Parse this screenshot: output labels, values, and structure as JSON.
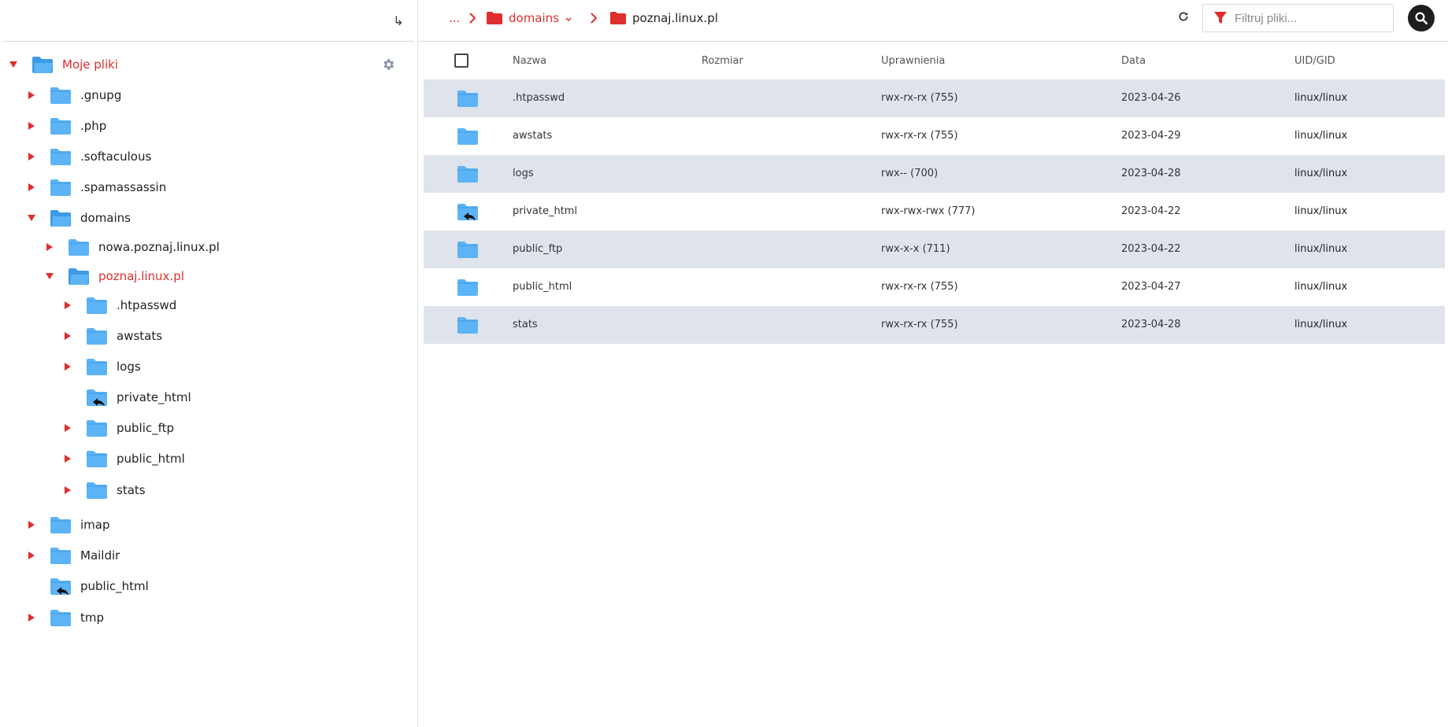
{
  "colors": {
    "accent": "#e02d2d",
    "folder": "#5cb3f5",
    "folder_dark": "#3d9be6",
    "row_shaded": "#dfe4ec"
  },
  "sidebar": {
    "collapse_icon": "arrow-down-right-icon",
    "root": {
      "label": "Moje pliki",
      "expanded": true
    },
    "settings_icon": "gear-icon",
    "tree": [
      {
        "label": ".gnupg",
        "toggle": "collapsed",
        "icon": "folder"
      },
      {
        "label": ".php",
        "toggle": "collapsed",
        "icon": "folder"
      },
      {
        "label": ".softaculous",
        "toggle": "collapsed",
        "icon": "folder"
      },
      {
        "label": ".spamassassin",
        "toggle": "collapsed",
        "icon": "folder"
      },
      {
        "label": "domains",
        "toggle": "expanded",
        "icon": "folder-open"
      },
      {
        "label": "nowa.poznaj.linux.pl",
        "toggle": "collapsed",
        "icon": "folder"
      },
      {
        "label": "poznaj.linux.pl",
        "toggle": "expanded",
        "icon": "folder-open",
        "active": true
      },
      {
        "label": ".htpasswd",
        "toggle": "collapsed",
        "icon": "folder"
      },
      {
        "label": "awstats",
        "toggle": "collapsed",
        "icon": "folder"
      },
      {
        "label": "logs",
        "toggle": "collapsed",
        "icon": "folder"
      },
      {
        "label": "private_html",
        "toggle": "none",
        "icon": "folder-link"
      },
      {
        "label": "public_ftp",
        "toggle": "collapsed",
        "icon": "folder"
      },
      {
        "label": "public_html",
        "toggle": "collapsed",
        "icon": "folder"
      },
      {
        "label": "stats",
        "toggle": "collapsed",
        "icon": "folder"
      },
      {
        "label": "imap",
        "toggle": "collapsed",
        "icon": "folder"
      },
      {
        "label": "Maildir",
        "toggle": "collapsed",
        "icon": "folder"
      },
      {
        "label": "public_html",
        "toggle": "none",
        "icon": "folder-link"
      },
      {
        "label": "tmp",
        "toggle": "collapsed",
        "icon": "folder"
      }
    ]
  },
  "breadcrumb": {
    "ellipsis": "...",
    "items": [
      {
        "label": "domains",
        "has_dropdown": true
      },
      {
        "label": "poznaj.linux.pl",
        "has_dropdown": false
      }
    ]
  },
  "toolbar": {
    "refresh_icon": "refresh-icon",
    "filter_icon": "filter-icon",
    "filter_placeholder": "Filtruj pliki...",
    "search_icon": "search-icon"
  },
  "table": {
    "columns": {
      "name": "Nazwa",
      "size": "Rozmiar",
      "perms": "Uprawnienia",
      "date": "Data",
      "owner": "UID/GID"
    },
    "rows": [
      {
        "name": ".htpasswd",
        "size": "",
        "perms": "rwx-rx-rx (755)",
        "date": "2023-04-26",
        "owner": "linux/linux",
        "icon": "folder"
      },
      {
        "name": "awstats",
        "size": "",
        "perms": "rwx-rx-rx (755)",
        "date": "2023-04-29",
        "owner": "linux/linux",
        "icon": "folder"
      },
      {
        "name": "logs",
        "size": "",
        "perms": "rwx-- (700)",
        "date": "2023-04-28",
        "owner": "linux/linux",
        "icon": "folder"
      },
      {
        "name": "private_html",
        "size": "",
        "perms": "rwx-rwx-rwx (777)",
        "date": "2023-04-22",
        "owner": "linux/linux",
        "icon": "folder-link"
      },
      {
        "name": "public_ftp",
        "size": "",
        "perms": "rwx-x-x (711)",
        "date": "2023-04-22",
        "owner": "linux/linux",
        "icon": "folder"
      },
      {
        "name": "public_html",
        "size": "",
        "perms": "rwx-rx-rx (755)",
        "date": "2023-04-27",
        "owner": "linux/linux",
        "icon": "folder"
      },
      {
        "name": "stats",
        "size": "",
        "perms": "rwx-rx-rx (755)",
        "date": "2023-04-28",
        "owner": "linux/linux",
        "icon": "folder"
      }
    ]
  }
}
